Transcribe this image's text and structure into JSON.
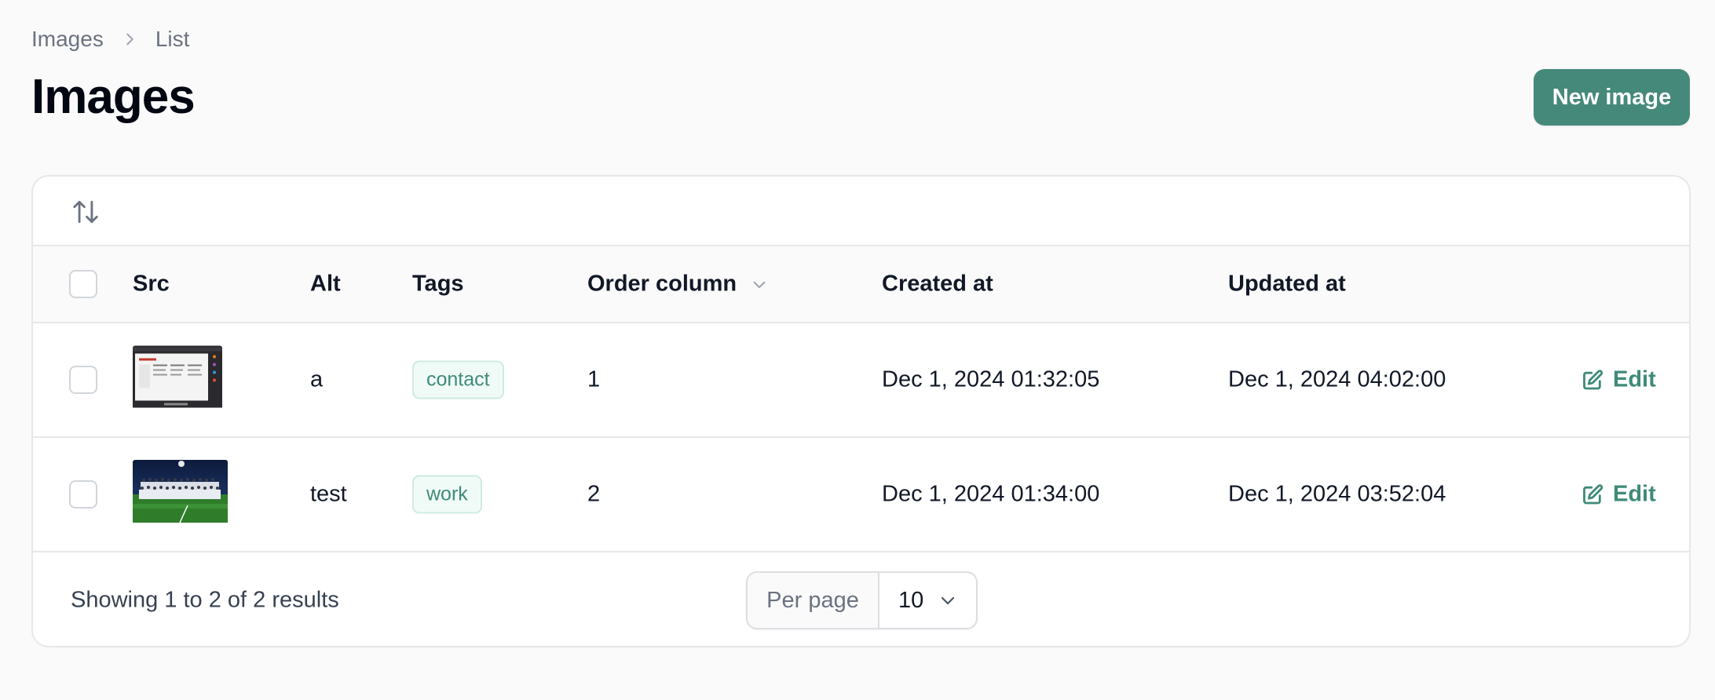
{
  "breadcrumb": {
    "items": [
      "Images",
      "List"
    ]
  },
  "page": {
    "title": "Images",
    "new_button": "New image"
  },
  "table": {
    "columns": {
      "src": "Src",
      "alt": "Alt",
      "tags": "Tags",
      "order": "Order column",
      "created": "Created at",
      "updated": "Updated at"
    },
    "rows": [
      {
        "alt": "a",
        "tag": "contact",
        "order": "1",
        "created": "Dec 1, 2024 01:32:05",
        "updated": "Dec 1, 2024 04:02:00",
        "action": "Edit"
      },
      {
        "alt": "test",
        "tag": "work",
        "order": "2",
        "created": "Dec 1, 2024 01:34:00",
        "updated": "Dec 1, 2024 03:52:04",
        "action": "Edit"
      }
    ]
  },
  "footer": {
    "results": "Showing 1 to 2 of 2 results",
    "per_page_label": "Per page",
    "per_page_value": "10"
  },
  "colors": {
    "accent": "#45897b",
    "accent_text": "#3f8a79"
  }
}
